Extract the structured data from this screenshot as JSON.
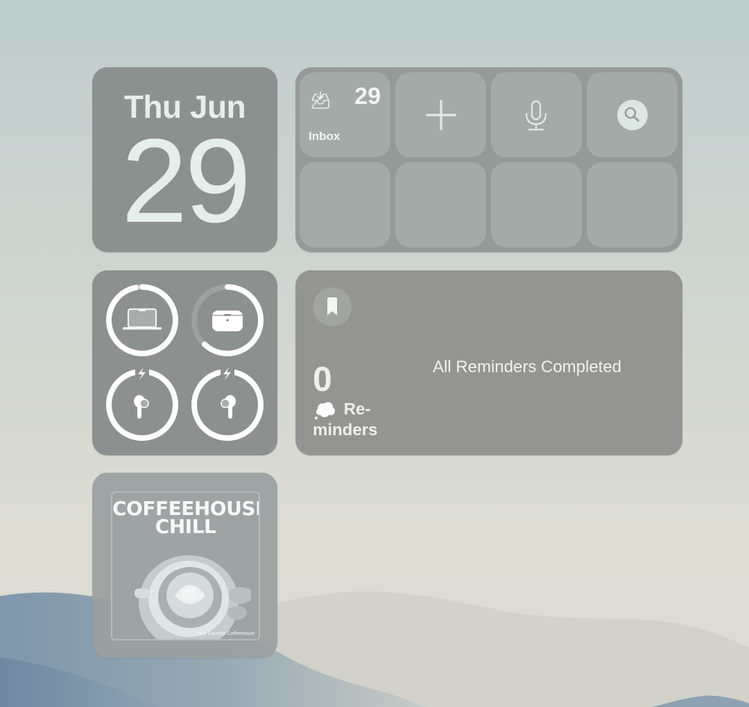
{
  "calendar": {
    "weekday_month": "Thu Jun",
    "day": "29"
  },
  "shortcuts": {
    "tiles": [
      {
        "name": "inbox",
        "icon": "inbox-tray-icon",
        "count": "29",
        "label": "Inbox"
      },
      {
        "name": "new-item",
        "icon": "plus-icon"
      },
      {
        "name": "dictate",
        "icon": "microphone-icon"
      },
      {
        "name": "search",
        "icon": "magnifying-glass-icon"
      },
      {
        "name": "empty-1"
      },
      {
        "name": "empty-2"
      },
      {
        "name": "empty-3"
      },
      {
        "name": "empty-4"
      }
    ]
  },
  "batteries": {
    "devices": [
      {
        "name": "MacBook",
        "icon": "laptop-icon",
        "level_percent": 97,
        "charging": false
      },
      {
        "name": "AirPods Case",
        "icon": "airpods-case-icon",
        "level_percent": 62,
        "charging": false
      },
      {
        "name": "AirPod Left",
        "icon": "airpod-left-icon",
        "level_percent": 100,
        "charging": true
      },
      {
        "name": "AirPod Right",
        "icon": "airpod-right-icon",
        "level_percent": 100,
        "charging": true
      }
    ]
  },
  "reminders": {
    "icon": "bookmark-icon",
    "count": "0",
    "list_icon": "thought-cloud-emoji",
    "list_name_line1": "Re-",
    "list_name_line2": "minders",
    "status": "All Reminders Completed"
  },
  "music": {
    "album_title_line1": "COFFEEHOUSE",
    "album_title_line2": "CHILL",
    "album_subtitle": "Your Favorite Coffeehouse"
  },
  "colors": {
    "widget_bg": "#8b918f",
    "text_light": "#e4efec",
    "ring": "#ffffff"
  }
}
